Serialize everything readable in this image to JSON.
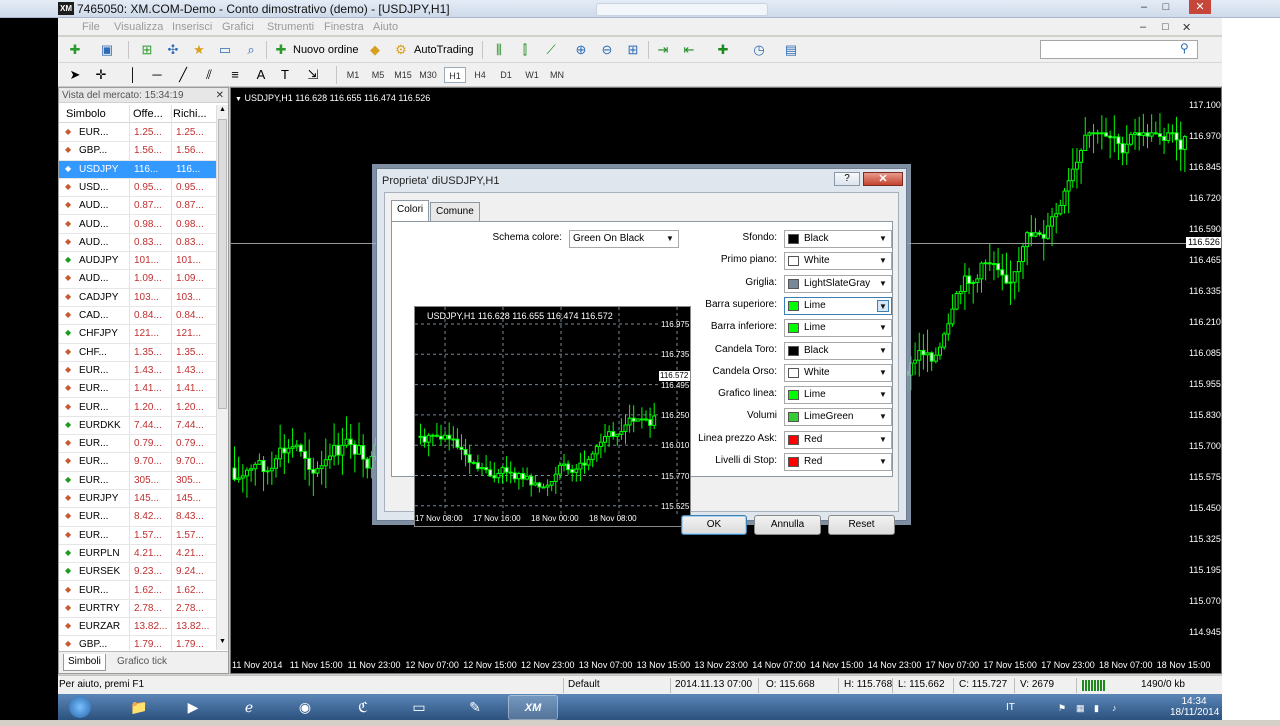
{
  "window": {
    "title": "7465050: XM.COM-Demo - Conto dimostrativo (demo) - [USDJPY,H1]",
    "logo": "XM",
    "controls": [
      "–",
      "□",
      "✕"
    ],
    "inner_controls": [
      "–",
      "□",
      "✕"
    ]
  },
  "menu": [
    "File",
    "Visualizza",
    "Inserisci",
    "Grafici",
    "Strumenti",
    "Finestra",
    "Aiuto"
  ],
  "toolbar": {
    "new_order": "Nuovo ordine",
    "autotrading": "AutoTrading",
    "timeframes": [
      "M1",
      "M5",
      "M15",
      "M30",
      "H1",
      "H4",
      "D1",
      "W1",
      "MN"
    ],
    "active_timeframe": "H1",
    "search_placeholder": ""
  },
  "market_watch": {
    "title": "Vista del mercato: 15:34:19",
    "columns": [
      "Simbolo",
      "Offe...",
      "Richi..."
    ],
    "rows": [
      {
        "symbol": "EUR...",
        "bid": "1.25...",
        "ask": "1.25...",
        "dir": "down"
      },
      {
        "symbol": "GBP...",
        "bid": "1.56...",
        "ask": "1.56...",
        "dir": "down"
      },
      {
        "symbol": "USDJPY",
        "bid": "116...",
        "ask": "116...",
        "dir": "up"
      },
      {
        "symbol": "USD...",
        "bid": "0.95...",
        "ask": "0.95...",
        "dir": "down"
      },
      {
        "symbol": "AUD...",
        "bid": "0.87...",
        "ask": "0.87...",
        "dir": "down"
      },
      {
        "symbol": "AUD...",
        "bid": "0.98...",
        "ask": "0.98...",
        "dir": "down"
      },
      {
        "symbol": "AUD...",
        "bid": "0.83...",
        "ask": "0.83...",
        "dir": "down"
      },
      {
        "symbol": "AUDJPY",
        "bid": "101...",
        "ask": "101...",
        "dir": "up"
      },
      {
        "symbol": "AUD...",
        "bid": "1.09...",
        "ask": "1.09...",
        "dir": "down"
      },
      {
        "symbol": "CADJPY",
        "bid": "103...",
        "ask": "103...",
        "dir": "down"
      },
      {
        "symbol": "CAD...",
        "bid": "0.84...",
        "ask": "0.84...",
        "dir": "down"
      },
      {
        "symbol": "CHFJPY",
        "bid": "121...",
        "ask": "121...",
        "dir": "up"
      },
      {
        "symbol": "CHF...",
        "bid": "1.35...",
        "ask": "1.35...",
        "dir": "down"
      },
      {
        "symbol": "EUR...",
        "bid": "1.43...",
        "ask": "1.43...",
        "dir": "down"
      },
      {
        "symbol": "EUR...",
        "bid": "1.41...",
        "ask": "1.41...",
        "dir": "down"
      },
      {
        "symbol": "EUR...",
        "bid": "1.20...",
        "ask": "1.20...",
        "dir": "down"
      },
      {
        "symbol": "EURDKK",
        "bid": "7.44...",
        "ask": "7.44...",
        "dir": "up"
      },
      {
        "symbol": "EUR...",
        "bid": "0.79...",
        "ask": "0.79...",
        "dir": "down"
      },
      {
        "symbol": "EUR...",
        "bid": "9.70...",
        "ask": "9.70...",
        "dir": "down"
      },
      {
        "symbol": "EUR...",
        "bid": "305...",
        "ask": "305...",
        "dir": "up"
      },
      {
        "symbol": "EURJPY",
        "bid": "145...",
        "ask": "145...",
        "dir": "down"
      },
      {
        "symbol": "EUR...",
        "bid": "8.42...",
        "ask": "8.43...",
        "dir": "down"
      },
      {
        "symbol": "EUR...",
        "bid": "1.57...",
        "ask": "1.57...",
        "dir": "down"
      },
      {
        "symbol": "EURPLN",
        "bid": "4.21...",
        "ask": "4.21...",
        "dir": "up"
      },
      {
        "symbol": "EURSEK",
        "bid": "9.23...",
        "ask": "9.24...",
        "dir": "up"
      },
      {
        "symbol": "EUR...",
        "bid": "1.62...",
        "ask": "1.62...",
        "dir": "down"
      },
      {
        "symbol": "EURTRY",
        "bid": "2.78...",
        "ask": "2.78...",
        "dir": "down"
      },
      {
        "symbol": "EURZAR",
        "bid": "13.82...",
        "ask": "13.82...",
        "dir": "down"
      },
      {
        "symbol": "GBP...",
        "bid": "1.79...",
        "ask": "1.79...",
        "dir": "down"
      }
    ],
    "tabs": [
      "Simboli",
      "Grafico tick"
    ]
  },
  "chart": {
    "header": "USDJPY,H1  116.628 116.655 116.474 116.526",
    "y_ticks": [
      "117.100",
      "116.970",
      "116.845",
      "116.720",
      "116.590",
      "116.465",
      "116.335",
      "116.210",
      "116.085",
      "115.955",
      "115.830",
      "115.700",
      "115.575",
      "115.450",
      "115.325",
      "115.195",
      "115.070",
      "114.945"
    ],
    "current_price": "116.526",
    "x_ticks": [
      "11 Nov 2014",
      "11 Nov 15:00",
      "11 Nov 23:00",
      "12 Nov 07:00",
      "12 Nov 15:00",
      "12 Nov 23:00",
      "13 Nov 07:00",
      "13 Nov 15:00",
      "13 Nov 23:00",
      "14 Nov 07:00",
      "14 Nov 15:00",
      "14 Nov 23:00",
      "17 Nov 07:00",
      "17 Nov 15:00",
      "17 Nov 23:00",
      "18 Nov 07:00",
      "18 Nov 15:00"
    ],
    "candle_color": "#00ff00"
  },
  "dialog": {
    "title": "Proprieta' diUSDJPY,H1",
    "help": "?",
    "close": "✕",
    "tabs": [
      "Colori",
      "Comune"
    ],
    "scheme_label": "Schema colore:",
    "scheme_value": "Green On Black",
    "properties": [
      {
        "label": "Sfondo:",
        "value": "Black",
        "swatch": "#000000"
      },
      {
        "label": "Primo piano:",
        "value": "White",
        "swatch": "#ffffff"
      },
      {
        "label": "Griglia:",
        "value": "LightSlateGray",
        "swatch": "#778899"
      },
      {
        "label": "Barra superiore:",
        "value": "Lime",
        "swatch": "#00ff00"
      },
      {
        "label": "Barra inferiore:",
        "value": "Lime",
        "swatch": "#00ff00"
      },
      {
        "label": "Candela Toro:",
        "value": "Black",
        "swatch": "#000000"
      },
      {
        "label": "Candela Orso:",
        "value": "White",
        "swatch": "#ffffff"
      },
      {
        "label": "Grafico linea:",
        "value": "Lime",
        "swatch": "#00ff00"
      },
      {
        "label": "Volumi",
        "value": "LimeGreen",
        "swatch": "#32cd32"
      },
      {
        "label": "Linea prezzo Ask:",
        "value": "Red",
        "swatch": "#ff0000"
      },
      {
        "label": "Livelli di Stop:",
        "value": "Red",
        "swatch": "#ff0000"
      }
    ],
    "preview": {
      "header": "USDJPY,H1  116.628 116.655 116.474 116.572",
      "y_ticks": [
        "116.975",
        "116.735",
        "116.495",
        "116.250",
        "116.010",
        "115.770",
        "115.525"
      ],
      "price_tag": "116.572",
      "x_ticks": [
        "17 Nov 08:00",
        "17 Nov 16:00",
        "18 Nov 00:00",
        "18 Nov 08:00"
      ]
    },
    "buttons": {
      "ok": "OK",
      "cancel": "Annulla",
      "reset": "Reset"
    }
  },
  "status": {
    "help": "Per aiuto, premi F1",
    "profile": "Default",
    "datetime": "2014.11.13 07:00",
    "open": "O: 115.668",
    "high": "H: 115.768",
    "low": "L: 115.662",
    "close": "C: 115.727",
    "volume": "V: 2679",
    "traffic": "1490/0 kb"
  },
  "taskbar": {
    "lang": "IT",
    "time": "14:34",
    "date": "18/11/2014",
    "xm": "XM"
  }
}
